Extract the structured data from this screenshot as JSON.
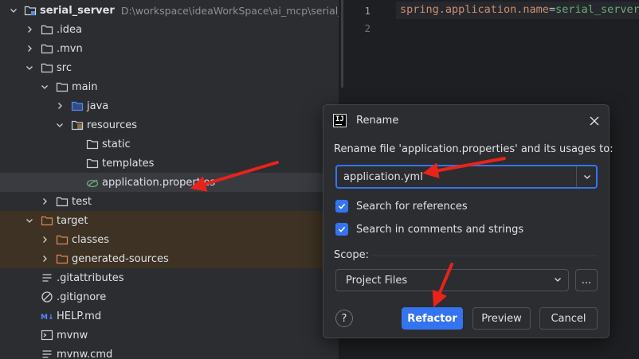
{
  "project_tree": {
    "root": {
      "name": "serial_server",
      "path": "D:\\workspace\\ideaWorkSpace\\ai_mcp\\serial_server"
    },
    "items": [
      {
        "label": "serial_server",
        "icon": "module-folder-icon",
        "chevron": "down"
      },
      {
        "label": ".idea",
        "icon": "folder-icon",
        "chevron": "right"
      },
      {
        "label": ".mvn",
        "icon": "folder-icon",
        "chevron": "right"
      },
      {
        "label": "src",
        "icon": "folder-icon",
        "chevron": "down"
      },
      {
        "label": "main",
        "icon": "folder-icon",
        "chevron": "down"
      },
      {
        "label": "java",
        "icon": "source-folder-icon",
        "chevron": "right"
      },
      {
        "label": "resources",
        "icon": "resources-folder-icon",
        "chevron": "down"
      },
      {
        "label": "static",
        "icon": "folder-icon",
        "chevron": "none"
      },
      {
        "label": "templates",
        "icon": "folder-icon",
        "chevron": "none"
      },
      {
        "label": "application.properties",
        "icon": "spring-properties-icon",
        "chevron": "none"
      },
      {
        "label": "test",
        "icon": "folder-icon",
        "chevron": "right"
      },
      {
        "label": "target",
        "icon": "excluded-folder-icon",
        "chevron": "down"
      },
      {
        "label": "classes",
        "icon": "excluded-folder-icon",
        "chevron": "right"
      },
      {
        "label": "generated-sources",
        "icon": "excluded-folder-icon",
        "chevron": "right"
      },
      {
        "label": ".gitattributes",
        "icon": "text-file-icon",
        "chevron": "none"
      },
      {
        "label": ".gitignore",
        "icon": "gitignore-icon",
        "chevron": "none"
      },
      {
        "label": "HELP.md",
        "icon": "markdown-icon",
        "chevron": "none"
      },
      {
        "label": "mvnw",
        "icon": "terminal-file-icon",
        "chevron": "none"
      },
      {
        "label": "mvnw.cmd",
        "icon": "text-file-icon",
        "chevron": "none"
      }
    ]
  },
  "editor": {
    "line_numbers": [
      "1",
      "2"
    ],
    "line1": {
      "key": "spring.application.name",
      "eq": "=",
      "value": "serial_server"
    }
  },
  "dialog": {
    "title": "Rename",
    "app_icon_text": "IJ",
    "prompt": "Rename file 'application.properties' and its usages to:",
    "new_name": "application.yml",
    "checkboxes": [
      {
        "label": "Search for references",
        "checked": true
      },
      {
        "label": "Search in comments and strings",
        "checked": true
      }
    ],
    "scope_label": "Scope:",
    "scope_value": "Project Files",
    "more_label": "...",
    "help_label": "?",
    "buttons": {
      "refactor": "Refactor",
      "preview": "Preview",
      "cancel": "Cancel"
    }
  },
  "colors": {
    "accent": "#3574f0",
    "tree_bg": "#2b2d30",
    "selected_row": "#393b40",
    "excluded_row": "#3d3223",
    "annotation_arrow": "#e8231a"
  }
}
